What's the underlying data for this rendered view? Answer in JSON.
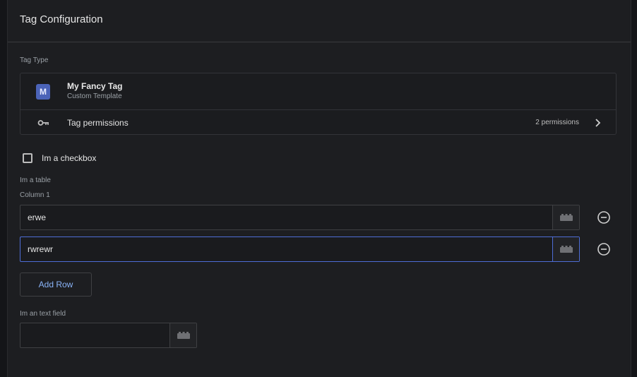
{
  "header": {
    "title": "Tag Configuration"
  },
  "tag_type": {
    "section_label": "Tag Type",
    "avatar_letter": "M",
    "name": "My Fancy Tag",
    "subtitle": "Custom Template",
    "permissions_label": "Tag permissions",
    "permissions_count": "2 permissions",
    "accent_color": "#4b63b8"
  },
  "checkbox": {
    "label": "Im a checkbox",
    "checked": false
  },
  "table": {
    "label": "Im a table",
    "column_header": "Column 1",
    "rows": [
      {
        "value": "erwe"
      },
      {
        "value": "rwrewr"
      }
    ],
    "add_row_label": "Add Row"
  },
  "text_field": {
    "label": "Im an text field",
    "value": ""
  },
  "icons": {
    "key": "key-icon",
    "chevron": "chevron-right-icon",
    "variable": "variable-bricks-icon",
    "remove": "remove-circle-icon"
  }
}
